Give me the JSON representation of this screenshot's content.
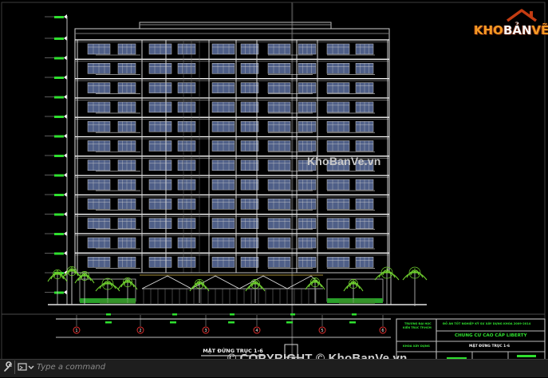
{
  "drawing": {
    "title_label": "MẶT ĐỨNG TRỤC 1-6",
    "grid_axes": [
      "1",
      "2",
      "3",
      "4",
      "5",
      "6"
    ],
    "title_block": {
      "school": "TRƯỜNG ĐẠI HỌC",
      "school_sub": "KIẾN TRÚC TP.HCM",
      "thesis": "ĐỒ ÁN TỐT NGHIỆP KỸ SƯ XÂY DỰNG KHÓA 2009-2014",
      "project": "CHUNG CƯ CAO CẤP LIBERTY",
      "faculty": "KHOA XÂY DỰNG",
      "sheet_title": "MẶT ĐỨNG TRỤC 1-6"
    }
  },
  "watermarks": {
    "center": "KhoBanVe.vn",
    "bottom": "© COPYRIGHT © KhoBanVe.vn"
  },
  "logo": {
    "part1": "KHO",
    "part2": "BẢN",
    "part3": "VẼ"
  },
  "command_line": {
    "placeholder": "Type a command"
  },
  "colors": {
    "background": "#000000",
    "building_lines": "#ffffff",
    "windows": "#4f5f88",
    "trees": "#6fcf2f",
    "level_markers": "#2fe02f",
    "logo_accent": "#f59a24",
    "logo_roof": "#c43c12"
  }
}
